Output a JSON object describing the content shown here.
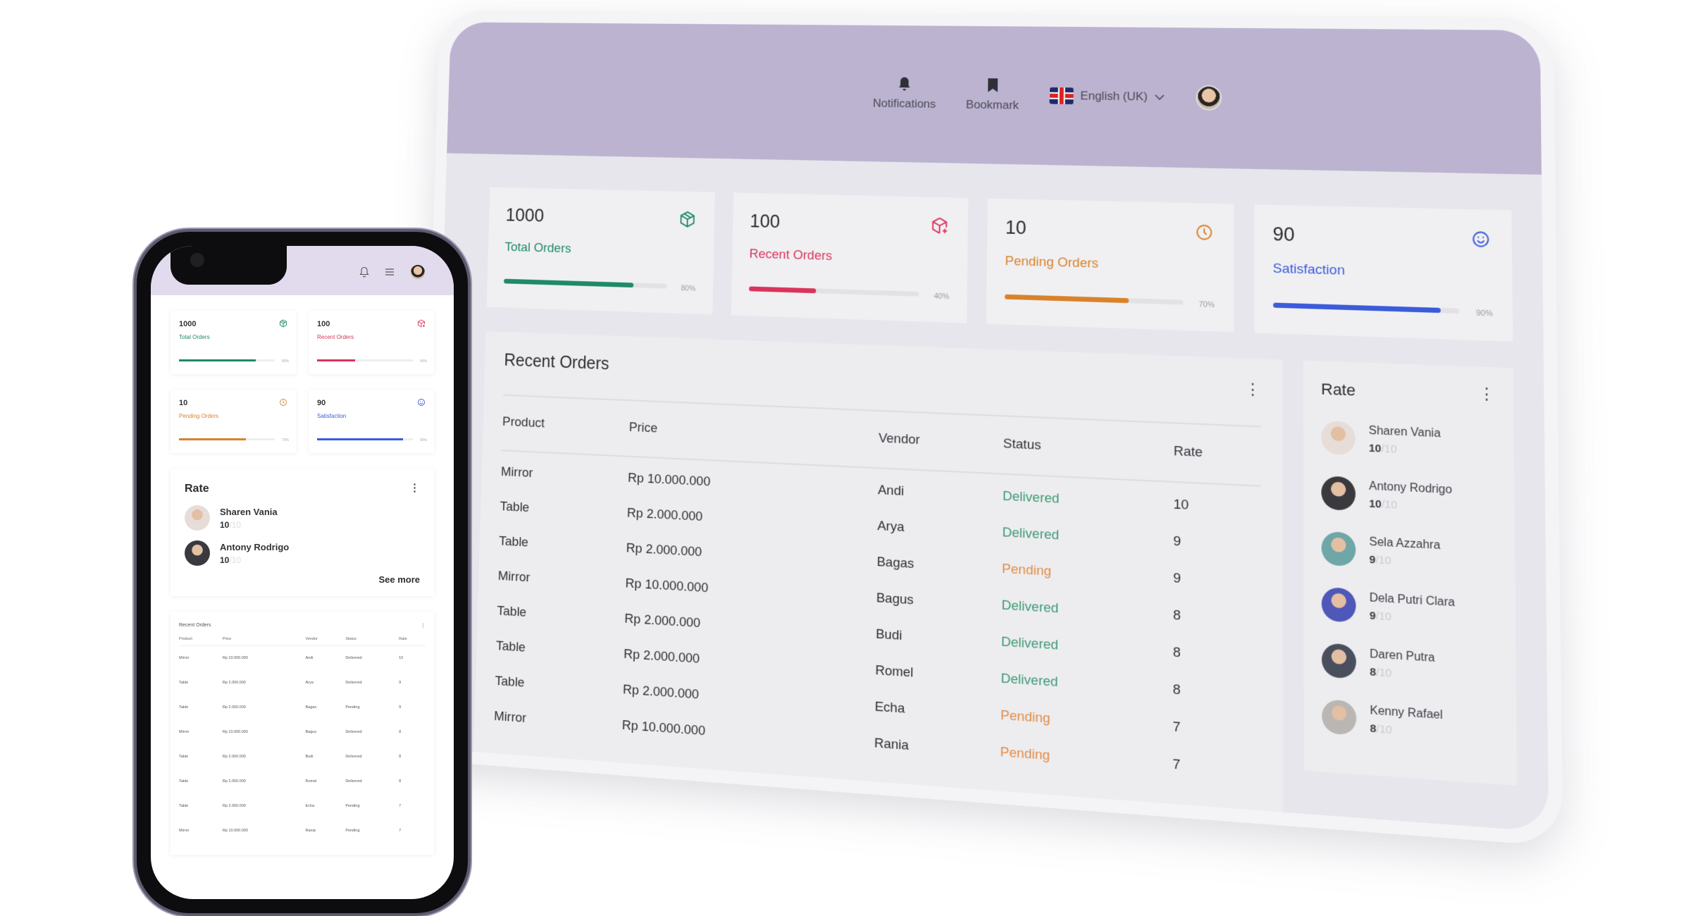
{
  "tablet": {
    "header": {
      "notifications_label": "Notifications",
      "bookmark_label": "Bookmark",
      "language_label": "English (UK)"
    },
    "stats": [
      {
        "value": "1000",
        "label": "Total Orders",
        "percent_label": "80%",
        "progress": 80,
        "color": "#1f8a66",
        "icon": "package-icon"
      },
      {
        "value": "100",
        "label": "Recent Orders",
        "percent_label": "40%",
        "progress": 40,
        "color": "#d9345b",
        "icon": "package-add-icon"
      },
      {
        "value": "10",
        "label": "Pending Orders",
        "percent_label": "70%",
        "progress": 70,
        "color": "#d9822b",
        "icon": "clock-icon"
      },
      {
        "value": "90",
        "label": "Satisfaction",
        "percent_label": "90%",
        "progress": 90,
        "color": "#3b5bd9",
        "icon": "smiley-icon"
      }
    ],
    "orders": {
      "title": "Recent Orders",
      "columns": [
        "Product",
        "Price",
        "Vendor",
        "Status",
        "Rate"
      ],
      "rows": [
        {
          "product": "Mirror",
          "price": "Rp 10.000.000",
          "vendor": "Andi",
          "status": "Delivered",
          "rate": "10"
        },
        {
          "product": "Table",
          "price": "Rp 2.000.000",
          "vendor": "Arya",
          "status": "Delivered",
          "rate": "9"
        },
        {
          "product": "Table",
          "price": "Rp 2.000.000",
          "vendor": "Bagas",
          "status": "Pending",
          "rate": "9"
        },
        {
          "product": "Mirror",
          "price": "Rp 10.000.000",
          "vendor": "Bagus",
          "status": "Delivered",
          "rate": "8"
        },
        {
          "product": "Table",
          "price": "Rp 2.000.000",
          "vendor": "Budi",
          "status": "Delivered",
          "rate": "8"
        },
        {
          "product": "Table",
          "price": "Rp 2.000.000",
          "vendor": "Romel",
          "status": "Delivered",
          "rate": "8"
        },
        {
          "product": "Table",
          "price": "Rp 2.000.000",
          "vendor": "Echa",
          "status": "Pending",
          "rate": "7"
        },
        {
          "product": "Mirror",
          "price": "Rp 10.000.000",
          "vendor": "Rania",
          "status": "Pending",
          "rate": "7"
        }
      ]
    },
    "rate": {
      "title": "Rate",
      "max": "/10",
      "people": [
        {
          "name": "Sharen Vania",
          "score": "10",
          "avatar_color": "#e6ddd8"
        },
        {
          "name": "Antony Rodrigo",
          "score": "10",
          "avatar_color": "#3a3a3e"
        },
        {
          "name": "Sela Azzahra",
          "score": "9",
          "avatar_color": "#6fa6a8"
        },
        {
          "name": "Dela Putri Clara",
          "score": "9",
          "avatar_color": "#4f58b8"
        },
        {
          "name": "Daren Putra",
          "score": "8",
          "avatar_color": "#4a4f5e"
        },
        {
          "name": "Kenny Rafael",
          "score": "8",
          "avatar_color": "#b9b6b4"
        }
      ]
    }
  },
  "phone": {
    "see_more": "See more",
    "rate_people_shown": 2
  },
  "colors": {
    "header_bg": "#bbb3d0",
    "phone_header_bg": "#e2dbee",
    "delivered": "#3e9a74",
    "pending": "#e38c45"
  }
}
